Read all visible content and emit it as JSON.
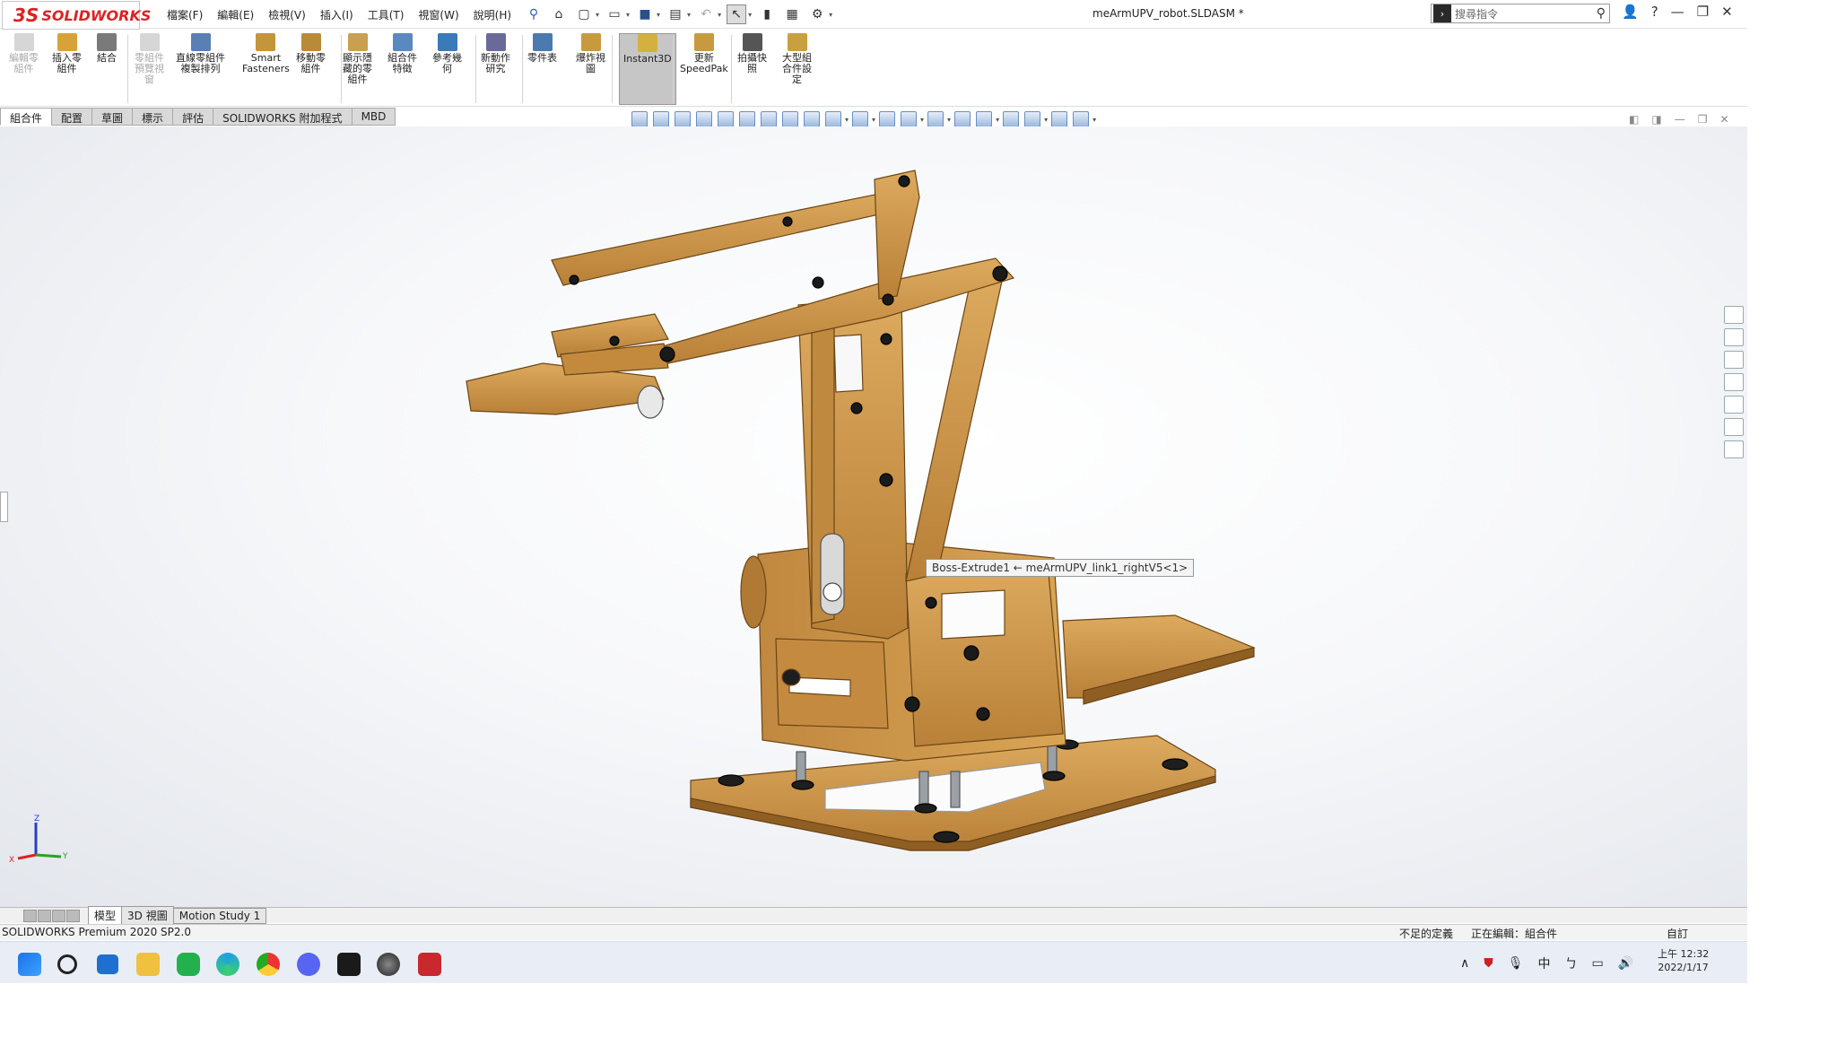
{
  "app": {
    "logo_text": "SOLIDWORKS",
    "logo_mark": "3S",
    "document_title": "meArmUPV_robot.SLDASM *"
  },
  "menu": [
    "檔案(F)",
    "編輯(E)",
    "檢視(V)",
    "插入(I)",
    "工具(T)",
    "視窗(W)",
    "說明(H)"
  ],
  "search": {
    "placeholder": "搜尋指令"
  },
  "ribbon": [
    {
      "label": "編輯零\n組件",
      "disabled": true,
      "color": "#8a8a8a"
    },
    {
      "label": "插入零\n組件",
      "disabled": false,
      "color": "#d8a23a"
    },
    {
      "label": "結合",
      "disabled": false,
      "color": "#7a7a7a"
    },
    {
      "label": "零組件\n預覽視\n窗",
      "disabled": true,
      "color": "#8a8a8a"
    },
    {
      "label": "直線零組件\n複製排列",
      "disabled": false,
      "color": "#5a7fb5"
    },
    {
      "label": "Smart\nFasteners",
      "disabled": false,
      "color": "#c4953a"
    },
    {
      "label": "移動零\n組件",
      "disabled": false,
      "color": "#b88a3a"
    },
    {
      "label": "顯示隱\n藏的零\n組件",
      "disabled": false,
      "color": "#c8a050"
    },
    {
      "label": "組合件\n特徵",
      "disabled": false,
      "color": "#5a88c0"
    },
    {
      "label": "參考幾\n何",
      "disabled": false,
      "color": "#3a7ab8"
    },
    {
      "label": "新動作\n研究",
      "disabled": false,
      "color": "#6a6a9a"
    },
    {
      "label": "零件表",
      "disabled": false,
      "color": "#4a7ab0"
    },
    {
      "label": "爆炸視\n圖",
      "disabled": false,
      "color": "#c89a40"
    },
    {
      "label": "Instant3D",
      "disabled": false,
      "active": true,
      "color": "#d4b040"
    },
    {
      "label": "更新\nSpeedPak",
      "disabled": false,
      "color": "#c89a40"
    },
    {
      "label": "拍攝快\n照",
      "disabled": false,
      "color": "#555"
    },
    {
      "label": "大型組\n合件設\n定",
      "disabled": false,
      "color": "#c8a040"
    }
  ],
  "tabs": [
    "組合件",
    "配置",
    "草圖",
    "標示",
    "評估",
    "SOLIDWORKS 附加程式",
    "MBD"
  ],
  "active_tab": "組合件",
  "tooltip": "Boss-Extrude1 ← meArmUPV_link1_rightV5<1>",
  "triad": {
    "x": "X",
    "y": "Y",
    "z": "Z"
  },
  "bottom_tabs": [
    "模型",
    "3D 視圖",
    "Motion Study 1"
  ],
  "status": {
    "left": "SOLIDWORKS Premium 2020 SP2.0",
    "defined": "不足的定義",
    "editing": "正在編輯：組合件",
    "custom": "自訂"
  },
  "taskbar": {
    "ime": "中",
    "time": "上午 12:32",
    "date": "2022/1/17"
  },
  "colors": {
    "wood": "#c98f3c",
    "wood_dark": "#9c6a28",
    "wood_light": "#d9a55a"
  }
}
